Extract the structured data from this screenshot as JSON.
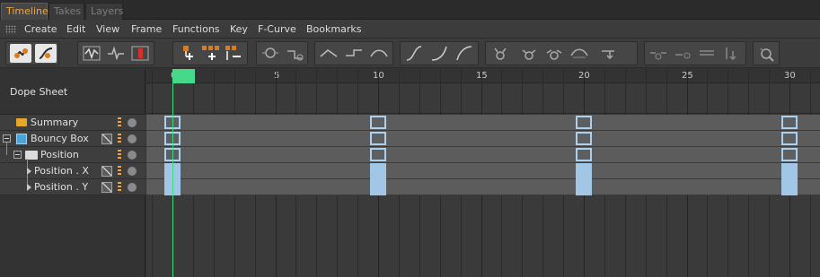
{
  "tabs": [
    {
      "label": "Timeline",
      "active": true
    },
    {
      "label": "Takes",
      "active": false
    },
    {
      "label": "Layers",
      "active": false
    }
  ],
  "menu": [
    "Create",
    "Edit",
    "View",
    "Frame",
    "Functions",
    "Key",
    "F-Curve",
    "Bookmarks"
  ],
  "toolbar_icons": [
    "key-mode-icon",
    "fcurve-mode-icon",
    "ripple-edit-icon",
    "waveform-icon",
    "autokey-record-icon",
    "add-key-icon",
    "add-keys-icon",
    "remove-keys-icon",
    "key-zero-icon",
    "key-step-icon",
    "ease-in-icon",
    "step-interp-icon",
    "ease-out-icon",
    "spline-icon",
    "linear-interp-icon",
    "soft-curve-icon",
    "lock-tangent-icon",
    "lock-tangent-angle-icon",
    "break-tangent-icon",
    "tangent-flat-icon",
    "tangent-clamp-icon",
    "zero-length-icon",
    "zero-angle-icon",
    "keep-visual-angle-icon",
    "key-reduce-icon",
    "settings-icon"
  ],
  "panel": {
    "title": "Dope Sheet"
  },
  "tracks": [
    {
      "label": "Summary",
      "type": "summary"
    },
    {
      "label": "Bouncy Box",
      "type": "object"
    },
    {
      "label": "Position",
      "type": "folder"
    },
    {
      "label": "Position . X",
      "type": "track"
    },
    {
      "label": "Position . Y",
      "type": "track"
    }
  ],
  "ruler": {
    "labels": [
      "0",
      "5",
      "10",
      "15",
      "20",
      "25",
      "30"
    ],
    "current_frame": 0
  },
  "keyframes": [
    0,
    10,
    20,
    30
  ],
  "colors": {
    "accent": "#f2a43a",
    "playhead": "#46d98a",
    "key_selected": "#a2c6e6"
  }
}
